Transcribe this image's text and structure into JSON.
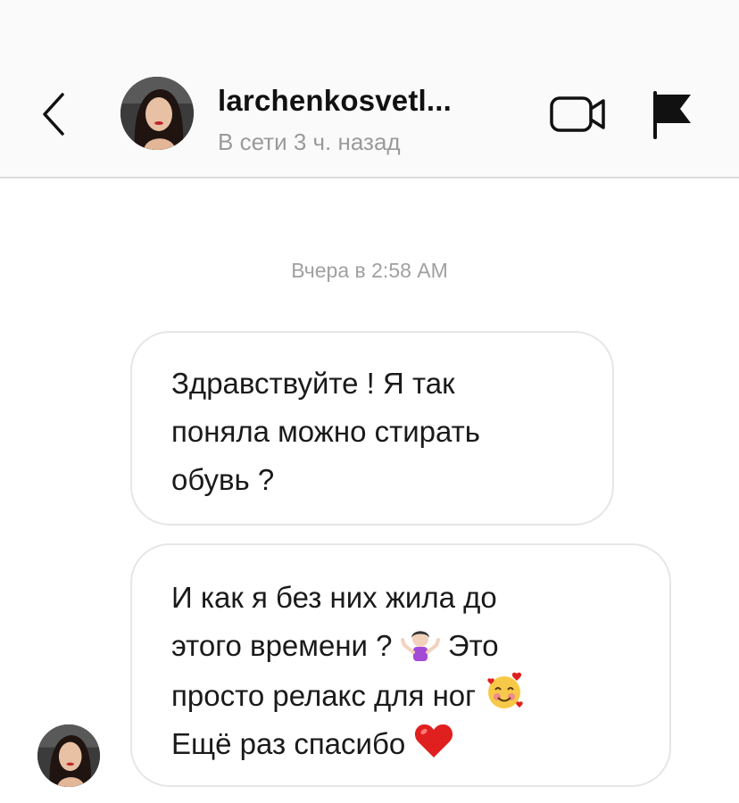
{
  "header": {
    "username": "larchenkosvetl...",
    "status": "В сети 3 ч. назад",
    "icons": {
      "back": "chevron-left-icon",
      "video": "video-camera-icon",
      "flag": "flag-icon"
    }
  },
  "chat": {
    "timestamp": "Вчера в 2:58 AM",
    "messages": [
      {
        "lines": [
          "Здравствуйте ! Я так",
          "поняла можно стирать",
          "обувь ?"
        ]
      },
      {
        "lines": [
          "И как я без них жила до",
          "этого времени ?",
          "Это",
          "просто релакс для ног",
          "Ещё раз спасибо"
        ],
        "emojis": [
          "person-shrugging-emoji",
          "smiling-face-with-hearts-emoji",
          "red-heart-emoji"
        ]
      }
    ]
  },
  "colors": {
    "header_bg": "#fafafa",
    "bubble_border": "#e6e6e6",
    "heart": "#e0201f"
  }
}
